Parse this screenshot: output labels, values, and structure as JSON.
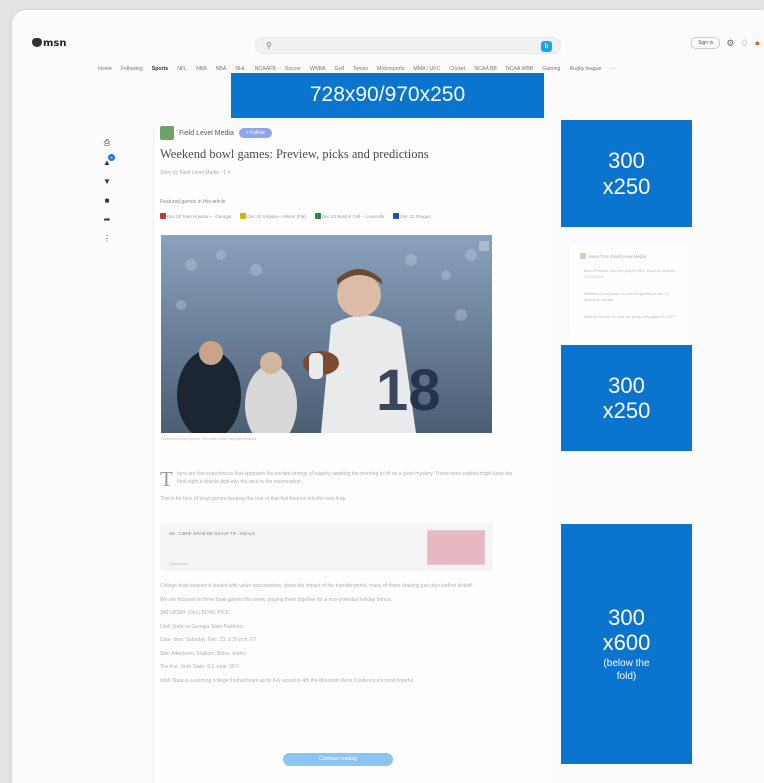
{
  "topbar": {
    "logo": "msn",
    "search_icon": "search-icon",
    "search_placeholder": "",
    "signin": "Sign in",
    "icons": [
      "gear-icon",
      "rewards-icon",
      "notification-icon"
    ]
  },
  "nav": {
    "items": [
      "Home",
      "Following",
      "Sports",
      "NFL",
      "NBA",
      "NBA",
      "NHL",
      "NCAAFB",
      "Soccer",
      "WNBA",
      "Golf",
      "Tennis",
      "Motorsports",
      "MMA / UFC",
      "Cricket",
      "NCAA BB",
      "NCAA WBB",
      "Gaming",
      "Rugby league",
      "···"
    ],
    "active_index": 2
  },
  "ads": {
    "top": "728x90/970x250",
    "right1_line1": "300",
    "right1_line2": "x250",
    "right2_line1": "300",
    "right2_line2": "x250",
    "right3_line1": "300",
    "right3_line2": "x600",
    "right3_note1": "(below the",
    "right3_note2": "fold)"
  },
  "left_rail": {
    "icons": [
      "print-icon",
      "like-icon",
      "dislike-icon",
      "comment-icon",
      "share-icon",
      "more-icon"
    ],
    "like_badge": "6"
  },
  "article": {
    "publisher": "Field Level Media",
    "follow_label": "+ Follow",
    "headline": "Weekend bowl games: Preview, picks and predictions",
    "byline": "Story by Field Level Media  ·  1 h",
    "featured_label": "Featured games in this article",
    "games": [
      "Dec 22 Sam Houston  -- Georgia",
      "Dec 22 Virginia -- Miami (Fla)",
      "Dec 23 Boston Coll -- Louisville",
      "Dec 23 Oregon"
    ],
    "photo_caption": "Weekend bowl games: Preview, picks and predictions",
    "dropcap": "T",
    "para1": "here are few experiences that approach the excited energy of eagerly awaiting the morning to hit on a giant mystery. Those more patient might keep the final night a double digit into the race to the examination.",
    "para2": "This is for fans of bowl games keeping the roar of that first bounce into the new leap.",
    "embed_title": "DK  ·  CBRE  GRAB BE SCALP TO  ·  DEALS",
    "embed_footer": "Sponsored",
    "lines": [
      "College bowl season is loaded with value opportunities, given the impact of the transfer portal, many of those drawing just days before kickoff.",
      "We are focused on three bowl games this week, playing them together for a nice potential holiday bonus.",
      "SATURDAY (Dec) BOWL PICK",
      "Utah State vs Georgia State Panthers",
      "Date, time: Saturday, Dec. 23, 1:30 p.m. ET",
      "Site: Albertsons Stadium, Boise, Idaho",
      "The line: Utah State -3.5, total: 58.5",
      "Utah State is a winning college football team as its 6-6 record in 4th the Mountain West Conference's most hopeful."
    ],
    "cta_label": "Continue reading"
  },
  "related": {
    "header": "More from Field Level Media",
    "items": [
      "Bowl Preview: who we picked SEC Bowl in Orlando 2023-2024",
      "Weekend bowl picks to look for games in the TV Money to be last",
      "Utah at Florida St: see our picks, key game in 2023"
    ]
  },
  "colors": {
    "ad_blue": "#0a74cf",
    "follow_chip": "#8fa5ee",
    "cta_chip": "#8ec3ef"
  }
}
